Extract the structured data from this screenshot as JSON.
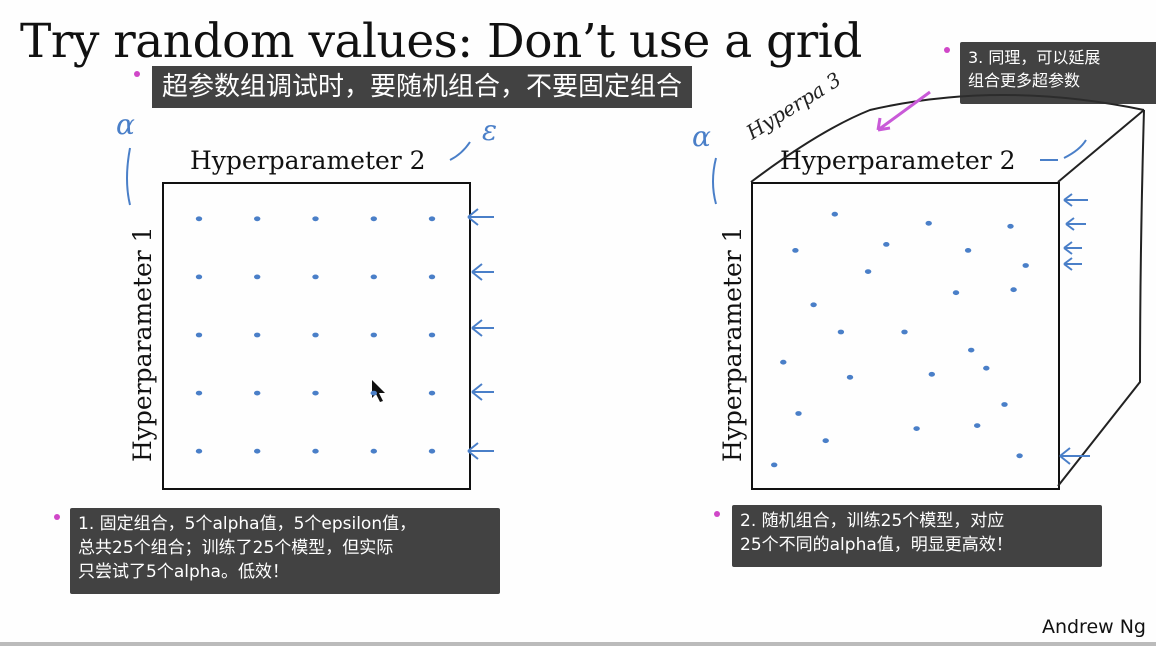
{
  "slide": {
    "title": "Try random values: Don’t use a grid",
    "subtitle_banner": "超参数组调试时，要随机组合，不要固定组合",
    "footer": "Andrew Ng"
  },
  "left_plot": {
    "xlabel": "Hyperparameter 2",
    "ylabel": "Hyperparameter 1",
    "handwritten_y": "α",
    "handwritten_x": "ε"
  },
  "right_plot": {
    "xlabel": "Hyperparameter 2",
    "ylabel": "Hyperparameter 1",
    "handwritten_y": "α",
    "handwritten_top": "Hyperpa 3"
  },
  "notes": {
    "note1": [
      "1. 固定组合，5个alpha值，5个epsilon值，",
      "总共25个组合；训练了25个模型，但实际",
      "只尝试了5个alpha。低效！"
    ],
    "note2": [
      "2. 随机组合，训练25个模型，对应",
      "25个不同的alpha值，明显更高效！"
    ],
    "note3": [
      "3. 同理，可以延展",
      "组合更多超参数"
    ]
  },
  "colors": {
    "ink_blue": "#4a7fc8",
    "note_bg": "#2d2d2d",
    "annotation_pink": "#c95ad8"
  },
  "chart_data": [
    {
      "type": "scatter",
      "title": "",
      "xlabel": "Hyperparameter 2",
      "ylabel": "Hyperparameter 1",
      "description": "5x5 grid of hyperparameter samples",
      "x": [
        1,
        2,
        3,
        4,
        5,
        1,
        2,
        3,
        4,
        5,
        1,
        2,
        3,
        4,
        5,
        1,
        2,
        3,
        4,
        5,
        1,
        2,
        3,
        4,
        5
      ],
      "y": [
        5,
        5,
        5,
        5,
        5,
        4,
        4,
        4,
        4,
        4,
        3,
        3,
        3,
        3,
        3,
        2,
        2,
        2,
        2,
        2,
        1,
        1,
        1,
        1,
        1
      ],
      "xlim": [
        0.4,
        5.6
      ],
      "ylim": [
        0.4,
        5.6
      ]
    },
    {
      "type": "scatter",
      "title": "",
      "xlabel": "Hyperparameter 2",
      "ylabel": "Hyperparameter 1",
      "description": "25 random hyperparameter samples",
      "x": [
        0.27,
        0.58,
        0.85,
        0.14,
        0.44,
        0.71,
        0.9,
        0.38,
        0.67,
        0.86,
        0.2,
        0.29,
        0.5,
        0.72,
        0.1,
        0.32,
        0.59,
        0.77,
        0.83,
        0.15,
        0.24,
        0.54,
        0.74,
        0.07,
        0.88
      ],
      "y": [
        0.9,
        0.87,
        0.86,
        0.78,
        0.8,
        0.78,
        0.73,
        0.71,
        0.64,
        0.65,
        0.6,
        0.51,
        0.51,
        0.45,
        0.41,
        0.36,
        0.37,
        0.39,
        0.27,
        0.24,
        0.15,
        0.19,
        0.2,
        0.07,
        0.1
      ],
      "xlim": [
        0,
        1
      ],
      "ylim": [
        0,
        1
      ]
    }
  ]
}
